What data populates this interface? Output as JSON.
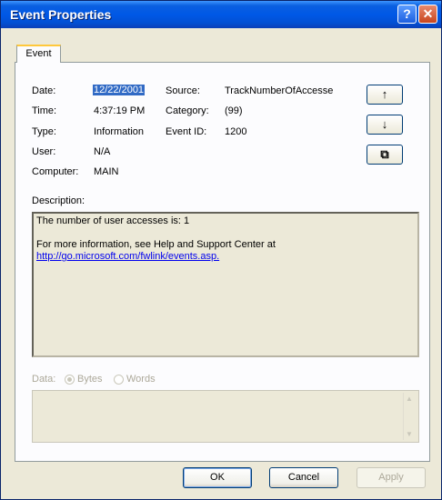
{
  "window": {
    "title": "Event Properties",
    "help_glyph": "?",
    "close_glyph": "✕"
  },
  "tabs": [
    {
      "label": "Event"
    }
  ],
  "event": {
    "date_label": "Date:",
    "date_value": "12/22/2001",
    "time_label": "Time:",
    "time_value": "4:37:19 PM",
    "type_label": "Type:",
    "type_value": "Information",
    "user_label": "User:",
    "user_value": "N/A",
    "computer_label": "Computer:",
    "computer_value": "MAIN",
    "source_label": "Source:",
    "source_value": "TrackNumberOfAccesse",
    "category_label": "Category:",
    "category_value": "(99)",
    "eventid_label": "Event ID:",
    "eventid_value": "1200"
  },
  "nav_buttons": {
    "up_glyph": "↑",
    "down_glyph": "↓",
    "copy_glyph": "⧉"
  },
  "description": {
    "label": "Description:",
    "line1": "The number of user accesses is: 1",
    "line2": "For more information, see Help and Support Center at",
    "link": "http://go.microsoft.com/fwlink/events.asp."
  },
  "data_section": {
    "label": "Data:",
    "bytes_label": "Bytes",
    "words_label": "Words",
    "selected": "Bytes"
  },
  "buttons": {
    "ok": "OK",
    "cancel": "Cancel",
    "apply": "Apply"
  },
  "colors": {
    "titlebar": "#0058e6",
    "selection": "#316ac5",
    "dialog_bg": "#ece9d8"
  },
  "icons": {
    "help": "help-icon",
    "close": "close-icon",
    "up": "arrow-up-icon",
    "down": "arrow-down-icon",
    "copy": "copy-icon"
  }
}
